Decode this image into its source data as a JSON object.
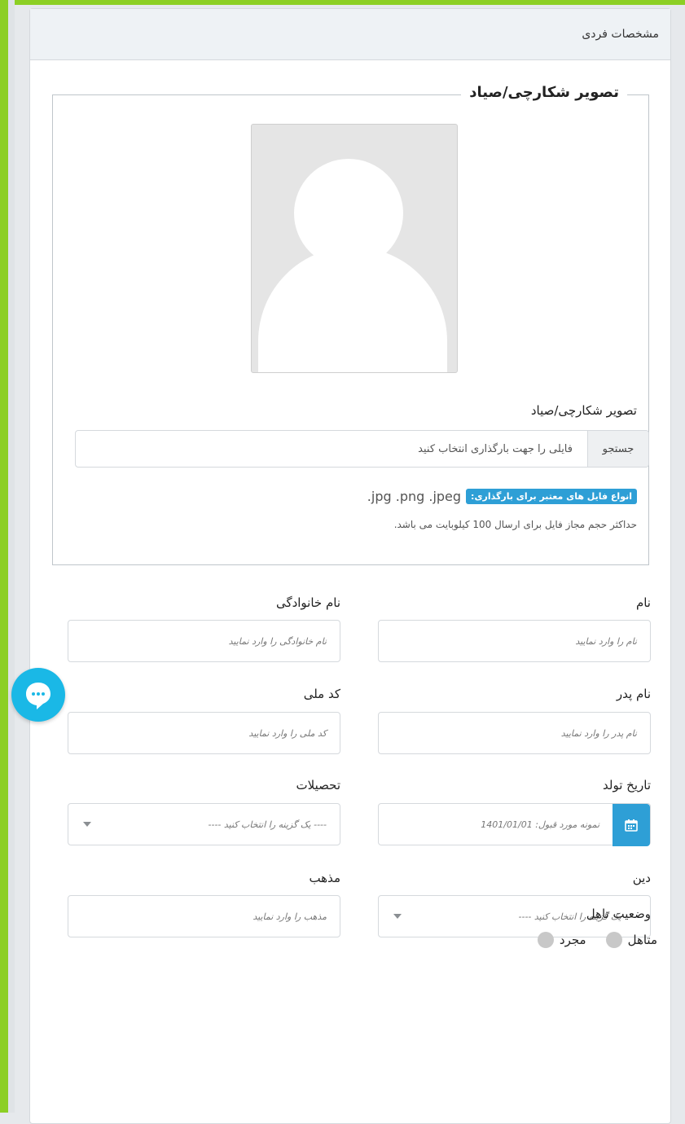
{
  "card": {
    "title": "مشخصات فردی"
  },
  "photo": {
    "legend": "تصویر شکارچی/صیاد",
    "upload_label": "تصویر شکارچی/صیاد",
    "browse_label": "جستجو",
    "file_placeholder": "فایلی را جهت بارگذاری انتخاب کنید",
    "valid_types_badge": "انواع فایل های معتبر برای بارگذاری:",
    "valid_types": ".jpg .png .jpeg",
    "size_note": "حداکثر حجم مجاز فایل برای ارسال 100 کیلوبایت می باشد."
  },
  "fields": {
    "first_name": {
      "label": "نام",
      "placeholder": "نام را وارد نمایید"
    },
    "last_name": {
      "label": "نام خانوادگی",
      "placeholder": "نام خانوادگی را وارد نمایید"
    },
    "father_name": {
      "label": "نام پدر",
      "placeholder": "نام پدر را وارد نمایید"
    },
    "national_code": {
      "label": "کد ملی",
      "placeholder": "کد ملی را وارد نمایید"
    },
    "birth_date": {
      "label": "تاریخ تولد",
      "placeholder": "نمونه مورد قبول: 1401/01/01"
    },
    "education": {
      "label": "تحصیلات",
      "placeholder": "---- یک گزینه را انتخاب کنید ----"
    },
    "religion": {
      "label": "دین",
      "placeholder": "---- یک گزینه را انتخاب کنید ----"
    },
    "sect": {
      "label": "مذهب",
      "placeholder": "مذهب را وارد نمایید"
    }
  },
  "marital": {
    "label": "وضعیت تاهل",
    "options": [
      "متاهل",
      "مجرد"
    ]
  },
  "colors": {
    "accent": "#2e9fd6",
    "chat": "#1ab8e6",
    "frame": "#8ccf24"
  }
}
